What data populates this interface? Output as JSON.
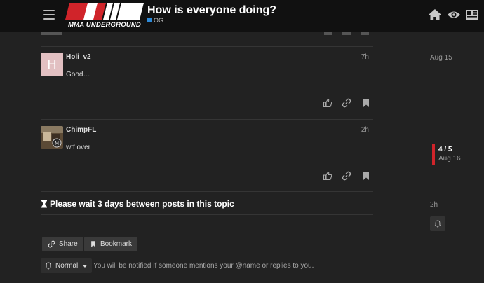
{
  "header": {
    "logo_text": "MMA UNDERGROUND",
    "topic_title": "How is everyone doing?",
    "category": {
      "label": "OG",
      "color": "#2e8ad8"
    },
    "icons": [
      "home-icon",
      "eye-icon",
      "newspaper-icon",
      "hamburger-icon"
    ]
  },
  "posts": [
    {
      "avatar_letter": "H",
      "username": "Holi_v2",
      "time": "7h",
      "body": "Good…"
    },
    {
      "username": "ChimpFL",
      "time": "2h",
      "body": "wtf over"
    }
  ],
  "post_actions": [
    "like-icon",
    "link-icon",
    "bookmark-icon"
  ],
  "notice": {
    "text": "Please wait 3 days between posts in this topic"
  },
  "footer": {
    "share_label": "Share",
    "bookmark_label": "Bookmark",
    "notification_level": "Normal",
    "notification_text": "You will be notified if someone mentions your @name or replies to you."
  },
  "timeline": {
    "start_date": "Aug 15",
    "position": "4 / 5",
    "current_date": "Aug 16",
    "end_label": "2h"
  },
  "colors": {
    "accent": "#d0242a",
    "background": "#222222",
    "header": "#111111"
  }
}
